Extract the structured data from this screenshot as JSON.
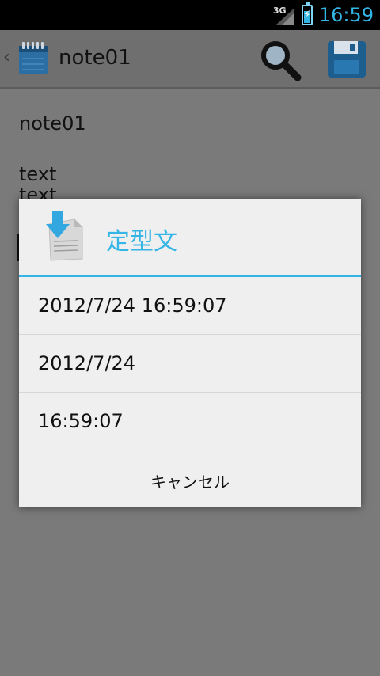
{
  "status_bar": {
    "network": "3G",
    "time": "16:59"
  },
  "action_bar": {
    "title": "note01",
    "up_icon": "back-caret-icon",
    "app_icon": "notepad-icon",
    "search_icon": "search-icon",
    "save_icon": "save-disk-icon"
  },
  "note": {
    "lines": [
      "note01",
      "text",
      "text"
    ]
  },
  "dialog": {
    "title": "定型文",
    "icon": "insert-document-icon",
    "items": [
      "2012/7/24 16:59:07",
      "2012/7/24",
      "16:59:07"
    ],
    "cancel_label": "キャンセル"
  },
  "colors": {
    "accent": "#33b5e5",
    "dialog_bg": "#efefef",
    "dim_bg": "#7a7a7a"
  }
}
